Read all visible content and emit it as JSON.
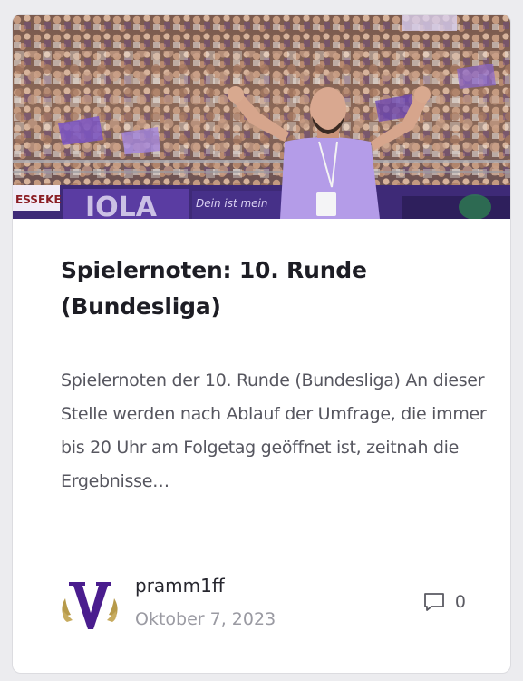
{
  "post": {
    "image_alt": "Fans in einem Stadion, ein Mann in lila T-Shirt jubelt mit erhobenen Armen",
    "title": "Spielernoten: 10. Runde (Bundesliga)",
    "excerpt": "Spielernoten der 10. Runde (Bundesliga) An dieser Stelle werden nach Ablauf der Umfrage, die immer bis 20 Uhr am Folgetag geöffnet ist, zeitnah die Ergebnisse…",
    "author": "pramm1ff",
    "date": "Oktober 7, 2023",
    "comment_count": "0",
    "comment_icon": "comment-bubble-icon"
  },
  "colors": {
    "brand_violet": "#4a1d8e",
    "accent_lavender": "#b9a6ec",
    "gold": "#b79a4a"
  },
  "hero_banner": {
    "left_text": "ESSEKE",
    "middle_text": "Dein ist mein"
  }
}
